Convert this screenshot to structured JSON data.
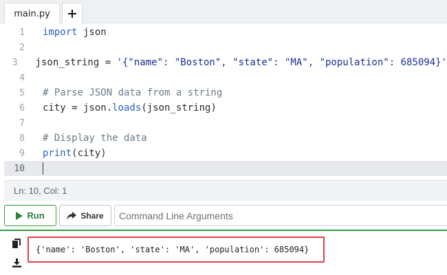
{
  "tabs": {
    "file_label": "main.py",
    "add_label": "+"
  },
  "editor": {
    "lines": [
      {
        "num": "1",
        "segments": [
          {
            "t": "import",
            "c": "kw"
          },
          {
            "t": " json",
            "c": ""
          }
        ]
      },
      {
        "num": "2",
        "segments": []
      },
      {
        "num": "3",
        "segments": [
          {
            "t": "json_string = ",
            "c": ""
          },
          {
            "t": "'{\"name\": \"Boston\", \"state\": \"MA\", \"population\": 685094}'",
            "c": "str"
          }
        ]
      },
      {
        "num": "4",
        "segments": []
      },
      {
        "num": "5",
        "segments": [
          {
            "t": "# Parse JSON data from a string",
            "c": "cmt"
          }
        ]
      },
      {
        "num": "6",
        "segments": [
          {
            "t": "city = json.",
            "c": ""
          },
          {
            "t": "loads",
            "c": "fn"
          },
          {
            "t": "(json_string)",
            "c": ""
          }
        ]
      },
      {
        "num": "7",
        "segments": []
      },
      {
        "num": "8",
        "segments": [
          {
            "t": "# Display the data",
            "c": "cmt"
          }
        ]
      },
      {
        "num": "9",
        "segments": [
          {
            "t": "print",
            "c": "fn"
          },
          {
            "t": "(city)",
            "c": ""
          }
        ]
      },
      {
        "num": "10",
        "segments": [],
        "active": true
      }
    ]
  },
  "status": {
    "cursor_position": "Ln: 10,  Col: 1"
  },
  "actions": {
    "run_label": "Run",
    "share_label": "Share",
    "args_placeholder": "Command Line Arguments"
  },
  "output": {
    "text": "{'name': 'Boston', 'state': 'MA', 'population': 685094}"
  },
  "icons": {
    "copy": "copy-icon",
    "download": "download-icon",
    "run": "play-icon",
    "share": "share-icon"
  },
  "colors": {
    "run_green": "#2e9a3e",
    "highlight_red": "#e24040",
    "keyword_blue": "#2a5fc2"
  }
}
